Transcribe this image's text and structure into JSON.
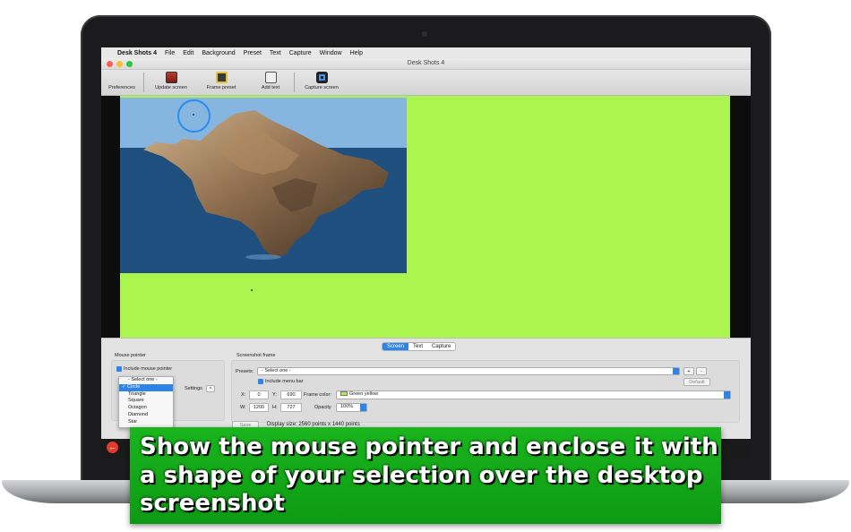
{
  "menubar": {
    "app_name": "Desk Shots 4",
    "items": [
      "File",
      "Edit",
      "Background",
      "Preset",
      "Text",
      "Capture",
      "Window",
      "Help"
    ]
  },
  "window": {
    "title": "Desk Shots 4"
  },
  "toolbar": {
    "buttons": [
      {
        "label": "Preferences",
        "icon": "preferences-icon"
      },
      {
        "label": "Update screen",
        "icon": "update-screen-icon"
      },
      {
        "label": "Frame preset",
        "icon": "frame-preset-icon"
      },
      {
        "label": "Add text",
        "icon": "add-text-icon"
      },
      {
        "label": "Capture screen",
        "icon": "camera-icon"
      }
    ]
  },
  "panel": {
    "tabs": [
      "Screen",
      "Text",
      "Capture"
    ],
    "active_tab": "Screen",
    "mouse_pointer": {
      "title": "Mouse pointer",
      "include_label": "Include mouse pointer",
      "settings_label": "Settings",
      "shape_menu": [
        "- Select one -",
        "Circle",
        "Triangle",
        "Square",
        "Octagon",
        "Diamond",
        "Star"
      ],
      "shape_selected": "Circle"
    },
    "screenshot_frame": {
      "title": "Screenshot frame",
      "presets_label": "Presets:",
      "presets_value": "- Select one -",
      "include_menu_bar": "Include menu bar",
      "default_button": "Default",
      "plus": "+",
      "minus": "-",
      "x_label": "X:",
      "x_value": "0",
      "y_label": "Y:",
      "y_value": "690",
      "w_label": "W:",
      "w_value": "1200",
      "h_label": "H:",
      "h_value": "727",
      "frame_color_label": "Frame color:",
      "frame_color_value": "Green yellow",
      "opacity_label": "Opacity",
      "opacity_value": "100%"
    },
    "save_button": "Save",
    "display_size": "Display size: 2560 points x 1440 points"
  },
  "banner": {
    "text": "Show the mouse pointer and enclose it with a shape of your selection over the desktop screenshot"
  },
  "colors": {
    "canvas_background": "#acf54f",
    "accent": "#2f84ea",
    "banner": "#14ad19"
  }
}
